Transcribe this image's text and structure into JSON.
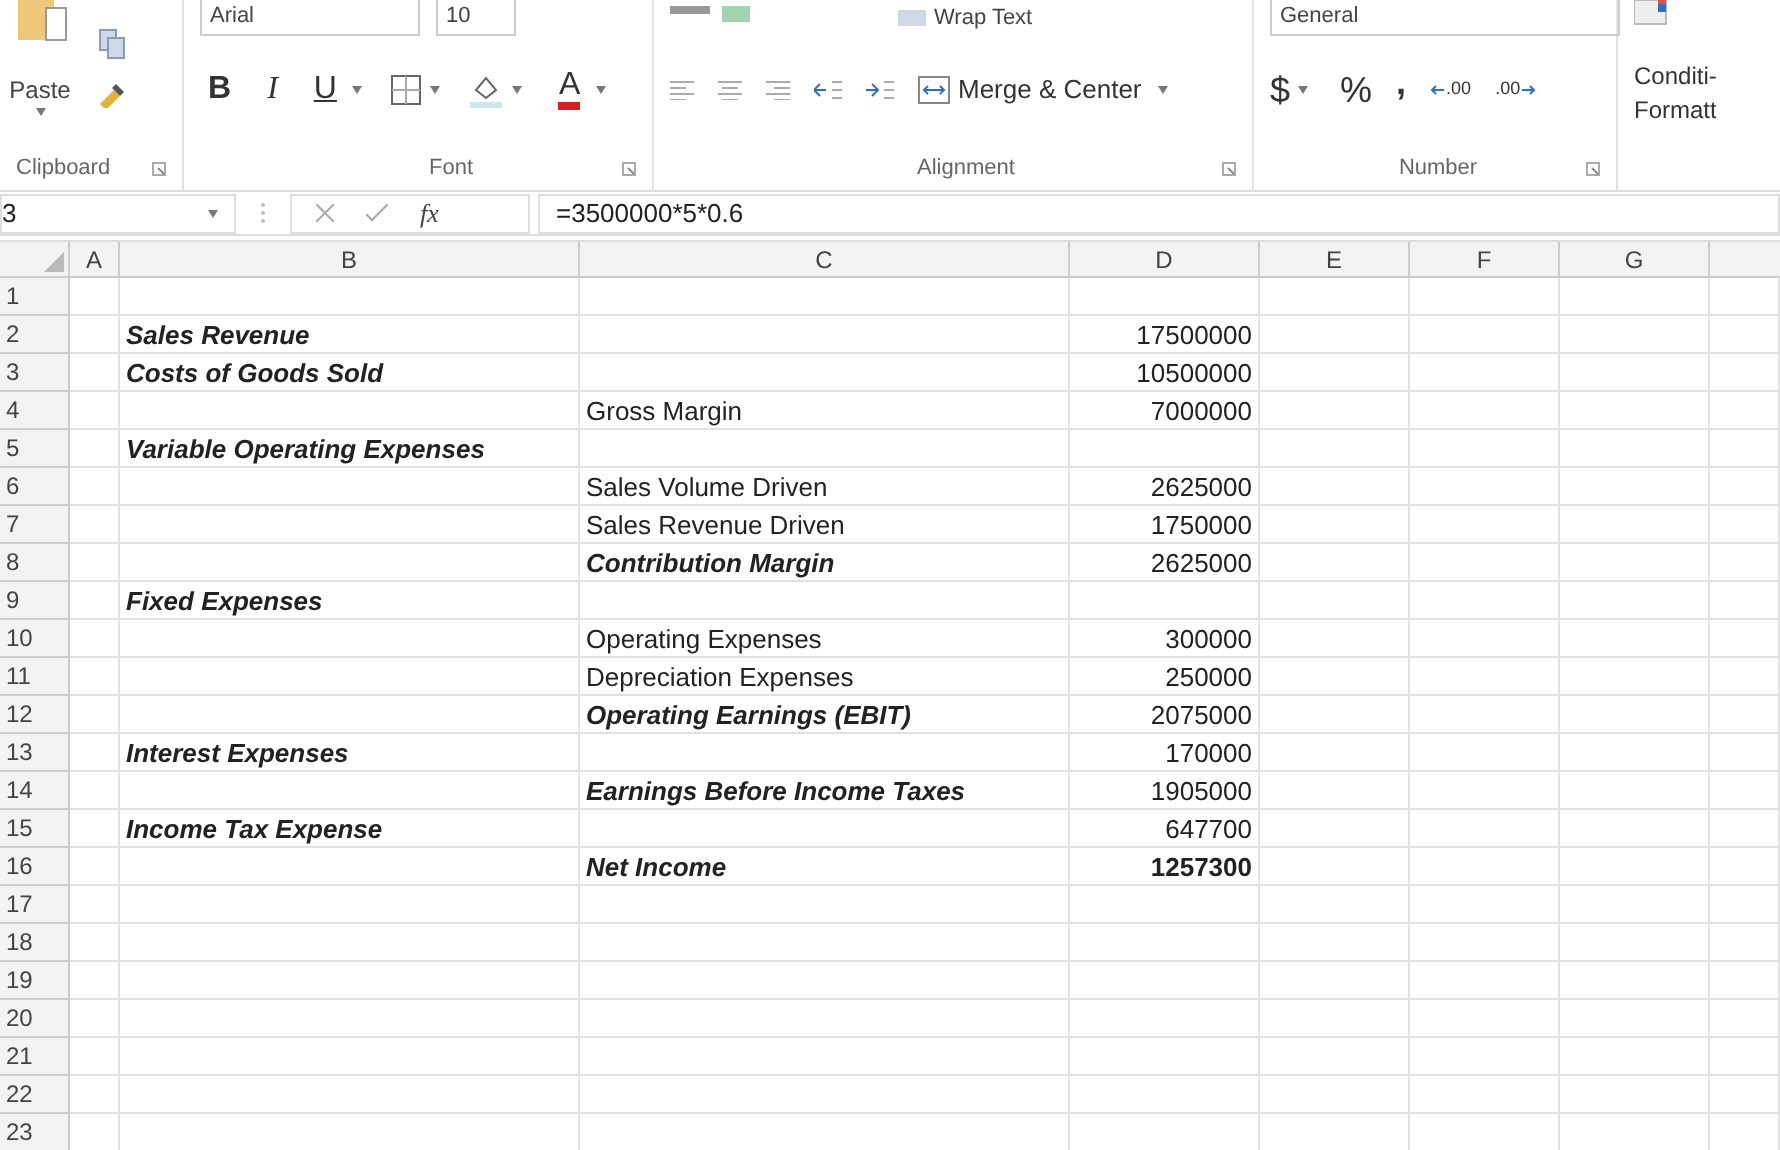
{
  "ribbon": {
    "font_name": "Arial",
    "font_size": "10",
    "wrap_text": "Wrap Text",
    "number_format": "General",
    "clipboard": {
      "paste": "Paste",
      "label": "Clipboard"
    },
    "font": {
      "bold": "B",
      "italic": "I",
      "underline": "U",
      "font_color": "A",
      "label": "Font"
    },
    "alignment": {
      "merge": "Merge & Center",
      "label": "Alignment"
    },
    "number": {
      "currency": "$",
      "percent": "%",
      "comma": ",",
      "increase_decimal": ".00",
      "decrease_decimal": ".00",
      "label": "Number"
    },
    "styles": {
      "conditional": "Conditi-",
      "formatting": "Formatt"
    }
  },
  "formula_bar": {
    "name_box": "3",
    "fx": "fx",
    "formula": "=3500000*5*0.6"
  },
  "columns": [
    "A",
    "B",
    "C",
    "D",
    "E",
    "F",
    "G"
  ],
  "rows": [
    {
      "number": "1"
    },
    {
      "number": "2",
      "b": {
        "text": "Sales Revenue",
        "bold": true
      },
      "d": {
        "text": "17500000",
        "bold": false
      }
    },
    {
      "number": "3",
      "b": {
        "text": "Costs of Goods Sold",
        "bold": true
      },
      "d": {
        "text": "10500000",
        "bold": false
      }
    },
    {
      "number": "4",
      "c": {
        "text": "Gross Margin",
        "bold": false
      },
      "d": {
        "text": "7000000",
        "bold": false
      }
    },
    {
      "number": "5",
      "b": {
        "text": "Variable Operating Expenses",
        "bold": true
      }
    },
    {
      "number": "6",
      "c": {
        "text": "Sales Volume Driven",
        "bold": false
      },
      "d": {
        "text": "2625000",
        "bold": false
      }
    },
    {
      "number": "7",
      "c": {
        "text": "Sales Revenue Driven",
        "bold": false
      },
      "d": {
        "text": "1750000",
        "bold": false
      }
    },
    {
      "number": "8",
      "c": {
        "text": "Contribution Margin",
        "bold": true
      },
      "d": {
        "text": "2625000",
        "bold": false
      }
    },
    {
      "number": "9",
      "b": {
        "text": "Fixed Expenses",
        "bold": true
      }
    },
    {
      "number": "10",
      "c": {
        "text": "Operating Expenses",
        "bold": false
      },
      "d": {
        "text": "300000",
        "bold": false
      }
    },
    {
      "number": "11",
      "c": {
        "text": "Depreciation Expenses",
        "bold": false
      },
      "d": {
        "text": "250000",
        "bold": false
      }
    },
    {
      "number": "12",
      "c": {
        "text": "Operating Earnings (EBIT)",
        "bold": true
      },
      "d": {
        "text": "2075000",
        "bold": false
      }
    },
    {
      "number": "13",
      "b": {
        "text": "Interest Expenses",
        "bold": true
      },
      "d": {
        "text": "170000",
        "bold": false
      }
    },
    {
      "number": "14",
      "c": {
        "text": "Earnings Before Income Taxes",
        "bold": true
      },
      "d": {
        "text": "1905000",
        "bold": false
      }
    },
    {
      "number": "15",
      "b": {
        "text": "Income Tax Expense",
        "bold": true
      },
      "d": {
        "text": "647700",
        "bold": false
      }
    },
    {
      "number": "16",
      "c": {
        "text": "Net Income",
        "bold": true
      },
      "d": {
        "text": "1257300",
        "bold": true
      }
    },
    {
      "number": "17"
    },
    {
      "number": "18"
    },
    {
      "number": "19"
    },
    {
      "number": "20"
    },
    {
      "number": "21"
    },
    {
      "number": "22"
    },
    {
      "number": "23"
    }
  ]
}
